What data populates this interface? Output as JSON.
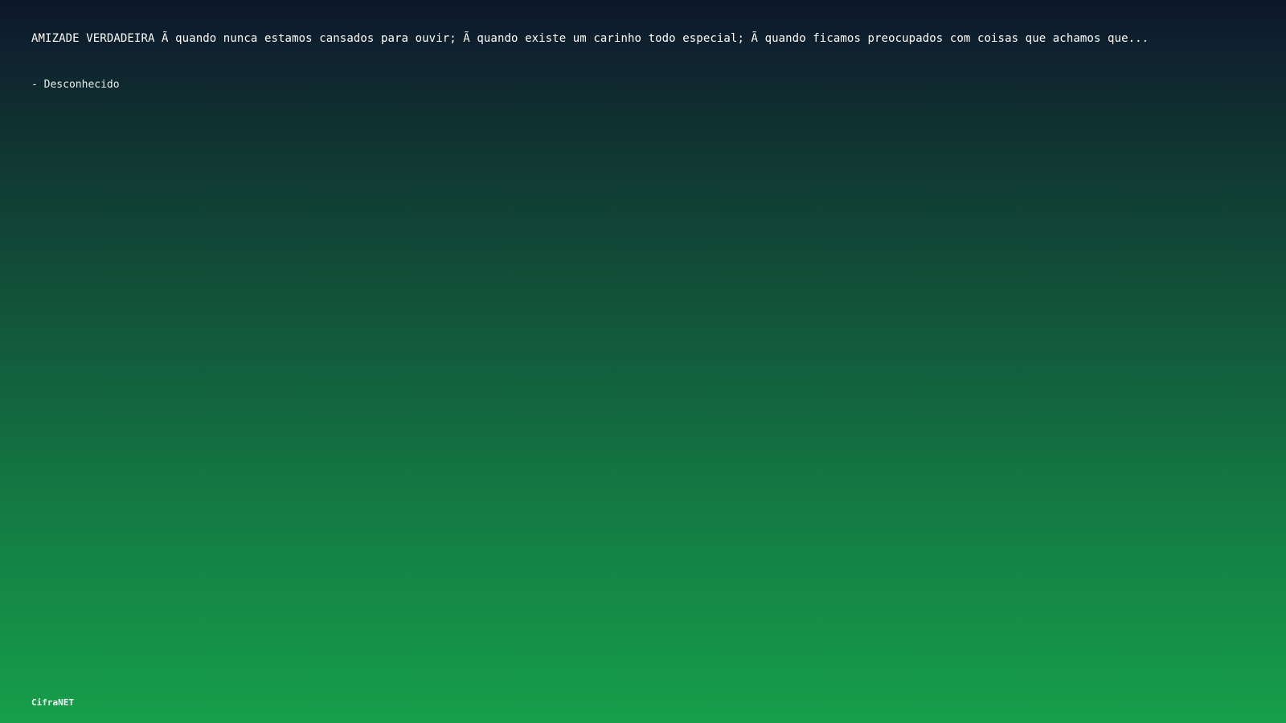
{
  "quote": {
    "text": "AMIZADE VERDADEIRA Ã  quando nunca estamos cansados para ouvir; Ã  quando existe um carinho todo especial; Ã  quando ficamos preocupados com coisas que achamos que...",
    "author": "- Desconhecido"
  },
  "brand": {
    "name": "CifraNET"
  }
}
